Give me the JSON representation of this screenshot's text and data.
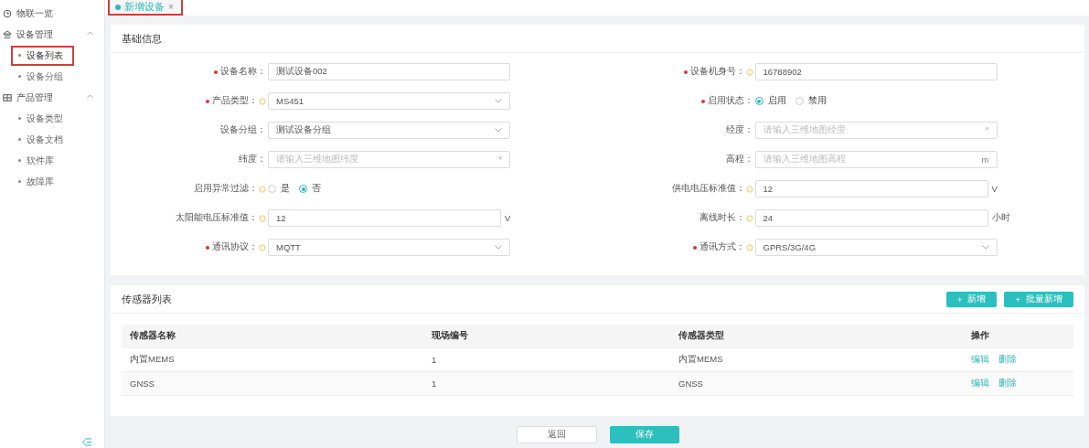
{
  "sidebar": {
    "items": [
      {
        "label": "物联一览"
      },
      {
        "label": "设备管理",
        "expanded": true,
        "children": [
          {
            "label": "设备列表",
            "selected": true,
            "highlighted": true
          },
          {
            "label": "设备分组",
            "selected": false,
            "highlighted": false
          }
        ]
      },
      {
        "label": "产品管理",
        "expanded": true,
        "children": [
          {
            "label": "设备类型",
            "selected": false,
            "highlighted": false
          },
          {
            "label": "设备文档",
            "selected": false,
            "highlighted": false
          },
          {
            "label": "软件库",
            "selected": false,
            "highlighted": false
          },
          {
            "label": "故障库",
            "selected": false,
            "highlighted": false
          }
        ]
      }
    ]
  },
  "tabs": [
    {
      "label": "新增设备",
      "close": "×",
      "selected": true,
      "highlighted": true
    }
  ],
  "basic_info": {
    "title": "基础信息",
    "fields": [
      {
        "kind": "input",
        "label": "设备名称：",
        "required": true,
        "help": false,
        "value": "测试设备002"
      },
      {
        "kind": "input",
        "label": "设备机身号：",
        "required": true,
        "help": true,
        "value": "16788902"
      },
      {
        "kind": "select",
        "label": "产品类型：",
        "required": true,
        "help": true,
        "value": "MS451"
      },
      {
        "kind": "radio",
        "label": "启用状态：",
        "required": true,
        "help": false,
        "options": [
          {
            "label": "启用",
            "selected": true
          },
          {
            "label": "禁用",
            "selected": false
          }
        ]
      },
      {
        "kind": "select",
        "label": "设备分组：",
        "required": false,
        "help": false,
        "value": "测试设备分组"
      },
      {
        "kind": "input",
        "label": "经度：",
        "required": false,
        "help": false,
        "placeholder": "请输入三维地图经度",
        "suffix": "°"
      },
      {
        "kind": "input",
        "label": "纬度：",
        "required": false,
        "help": false,
        "placeholder": "请输入三维地图纬度",
        "suffix": "°"
      },
      {
        "kind": "input",
        "label": "高程：",
        "required": false,
        "help": false,
        "placeholder": "请输入三维地图高程",
        "suffix": "m"
      },
      {
        "kind": "radio",
        "label": "启用异常过滤：",
        "required": false,
        "help": true,
        "options": [
          {
            "label": "是",
            "selected": false
          },
          {
            "label": "否",
            "selected": true
          }
        ]
      },
      {
        "kind": "input",
        "label": "供电电压标准值：",
        "required": false,
        "help": true,
        "value": "12",
        "unit": "V"
      },
      {
        "kind": "input",
        "label": "太阳能电压标准值：",
        "required": false,
        "help": true,
        "value": "12",
        "unit": "V"
      },
      {
        "kind": "input",
        "label": "离线时长：",
        "required": false,
        "help": true,
        "value": "24",
        "unit": "小时"
      },
      {
        "kind": "select",
        "label": "通讯协议：",
        "required": true,
        "help": true,
        "value": "MQTT"
      },
      {
        "kind": "select",
        "label": "通讯方式：",
        "required": true,
        "help": true,
        "value": "GPRS/3G/4G"
      }
    ]
  },
  "sensor_list": {
    "title": "传感器列表",
    "buttons": [
      {
        "icon": "+",
        "label": "新增"
      },
      {
        "icon": "+",
        "label": "批量新增"
      }
    ],
    "table": {
      "columns": [
        "传感器名称",
        "现场编号",
        "传感器类型",
        "操作"
      ],
      "rows": [
        {
          "name": "内置MEMS",
          "number": "1",
          "type": "内置MEMS",
          "actions": [
            "编辑",
            "删除"
          ]
        },
        {
          "name": "GNSS",
          "number": "1",
          "type": "GNSS",
          "actions": [
            "编辑",
            "删除"
          ]
        }
      ]
    }
  },
  "footer": {
    "buttons": [
      {
        "label": "返回",
        "primary": false
      },
      {
        "label": "保存",
        "primary": true
      }
    ]
  }
}
